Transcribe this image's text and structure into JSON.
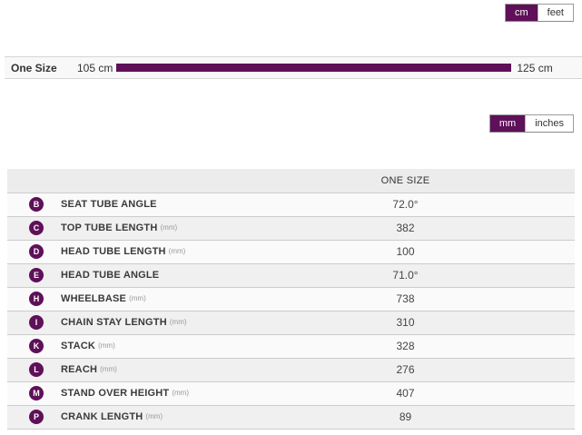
{
  "colors": {
    "accent_purple": "#5e1058",
    "header_gray": "#ececec",
    "row_gray": "#f0f0f0",
    "row_light": "#fafafa"
  },
  "size_unit_toggle": {
    "options": [
      {
        "label": "cm",
        "selected": true
      },
      {
        "label": "feet",
        "selected": false
      }
    ]
  },
  "size_bar": {
    "label": "One Size",
    "min_label": "105 cm",
    "max_label": "125 cm"
  },
  "geometry_unit_toggle": {
    "options": [
      {
        "label": "mm",
        "selected": true
      },
      {
        "label": "inches",
        "selected": false
      }
    ]
  },
  "geometry_table": {
    "column_header": "ONE SIZE",
    "rows": [
      {
        "badge": "B",
        "label": "SEAT TUBE ANGLE",
        "unit": "",
        "value": "72.0°"
      },
      {
        "badge": "C",
        "label": "TOP TUBE LENGTH",
        "unit": "(mm)",
        "value": "382"
      },
      {
        "badge": "D",
        "label": "HEAD TUBE LENGTH",
        "unit": "(mm)",
        "value": "100"
      },
      {
        "badge": "E",
        "label": "HEAD TUBE ANGLE",
        "unit": "",
        "value": "71.0°"
      },
      {
        "badge": "H",
        "label": "WHEELBASE",
        "unit": "(mm)",
        "value": "738"
      },
      {
        "badge": "I",
        "label": "CHAIN STAY LENGTH",
        "unit": "(mm)",
        "value": "310"
      },
      {
        "badge": "K",
        "label": "STACK",
        "unit": "(mm)",
        "value": "328"
      },
      {
        "badge": "L",
        "label": "REACH",
        "unit": "(mm)",
        "value": "276"
      },
      {
        "badge": "M",
        "label": "STAND OVER HEIGHT",
        "unit": "(mm)",
        "value": "407"
      },
      {
        "badge": "P",
        "label": "CRANK LENGTH",
        "unit": "(mm)",
        "value": "89"
      }
    ]
  }
}
